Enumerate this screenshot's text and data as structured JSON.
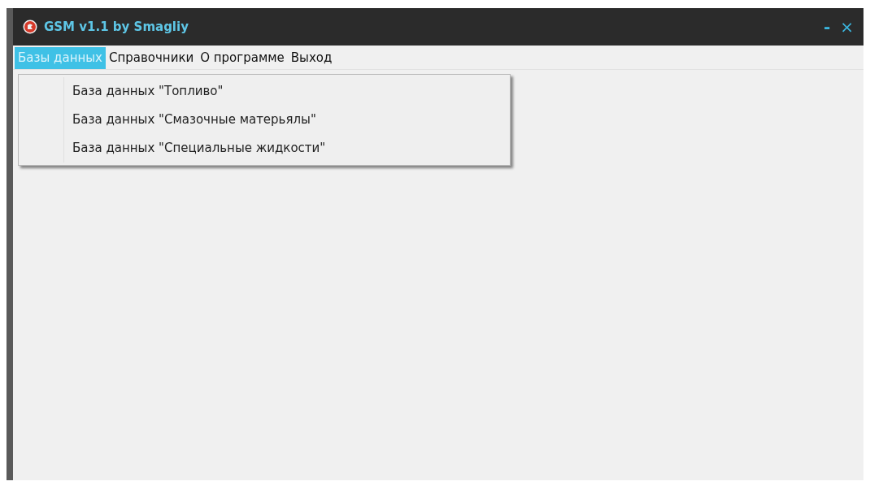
{
  "window": {
    "title": "GSM v1.1 by Smagliy",
    "controls": [
      {
        "kind": "minimize",
        "label": "-"
      },
      {
        "kind": "close",
        "label": "×"
      }
    ]
  },
  "menu_bar": [
    {
      "label": "Базы данных",
      "selected": true
    },
    {
      "label": "Справочники",
      "selected": false
    },
    {
      "label": "О программе",
      "selected": false
    },
    {
      "label": "Выход",
      "selected": false
    }
  ],
  "dropdown": {
    "items": [
      {
        "label": "База данных \"Топливо\""
      },
      {
        "label": "База данных \"Смазочные матерьялы\""
      },
      {
        "label": "База данных \"Специальные жидкости\""
      }
    ]
  }
}
